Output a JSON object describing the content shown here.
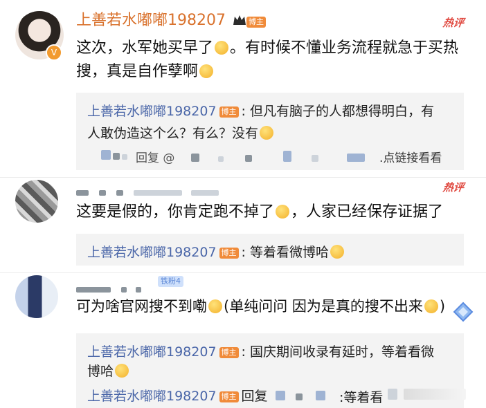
{
  "comments": [
    {
      "username": "上善若水嘟嘟198207",
      "role_badge": "博主",
      "hot_label": "热评",
      "text_line1": "这次，水军她买早了",
      "text_line1_tail": "。有时候不懂业务流程就急于买热",
      "text_line2": "搜，真是自作孽啊",
      "reply": {
        "username": "上善若水嘟嘟198207",
        "role_badge": "博主",
        "text_line1": ": 但凡有脑子的人都想得明白，有",
        "text_line2": "人敢伪造这个么？有么？没有",
        "footer_reply": "回复 @",
        "footer_link": ".点链接看看"
      }
    },
    {
      "hot_label": "热评",
      "text_a": "这要是假的，你肯定跑不掉了",
      "text_b": "，人家已经保存证据了",
      "reply": {
        "username": "上善若水嘟嘟198207",
        "role_badge": "博主",
        "text": ": 等着看微博哈"
      }
    },
    {
      "fan_badge": "铁粉4",
      "text_a": "可为啥官网搜不到嘞",
      "text_b": "(单纯问问 因为是真的搜不出来",
      "text_c": ")",
      "replies": [
        {
          "username": "上善若水嘟嘟198207",
          "role_badge": "博主",
          "text_line1": ": 国庆期间收录有延时，等着看微",
          "text_line2": "博哈"
        },
        {
          "username": "上善若水嘟嘟198207",
          "role_badge": "博主",
          "reply_word": "回复",
          "text": ":等着看"
        }
      ]
    }
  ],
  "colors": {
    "name": "#d9722d",
    "reply_name": "#4a66a8",
    "hot": "#e0483f",
    "badge": "#f08b3a"
  }
}
